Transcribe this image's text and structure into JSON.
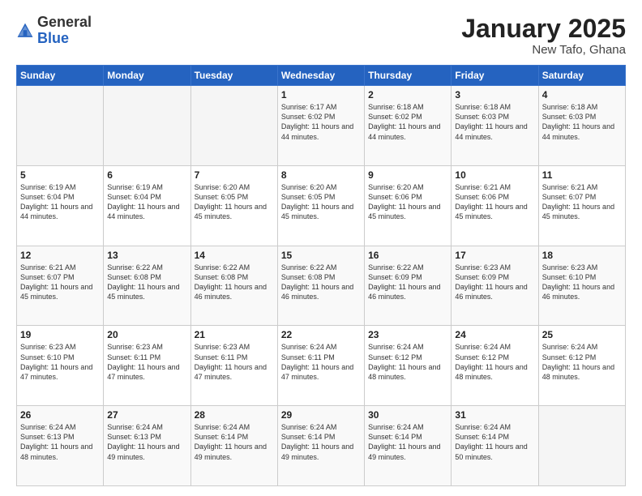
{
  "header": {
    "logo_general": "General",
    "logo_blue": "Blue",
    "month": "January 2025",
    "location": "New Tafo, Ghana"
  },
  "weekdays": [
    "Sunday",
    "Monday",
    "Tuesday",
    "Wednesday",
    "Thursday",
    "Friday",
    "Saturday"
  ],
  "weeks": [
    [
      {
        "day": "",
        "text": ""
      },
      {
        "day": "",
        "text": ""
      },
      {
        "day": "",
        "text": ""
      },
      {
        "day": "1",
        "text": "Sunrise: 6:17 AM\nSunset: 6:02 PM\nDaylight: 11 hours\nand 44 minutes."
      },
      {
        "day": "2",
        "text": "Sunrise: 6:18 AM\nSunset: 6:02 PM\nDaylight: 11 hours\nand 44 minutes."
      },
      {
        "day": "3",
        "text": "Sunrise: 6:18 AM\nSunset: 6:03 PM\nDaylight: 11 hours\nand 44 minutes."
      },
      {
        "day": "4",
        "text": "Sunrise: 6:18 AM\nSunset: 6:03 PM\nDaylight: 11 hours\nand 44 minutes."
      }
    ],
    [
      {
        "day": "5",
        "text": "Sunrise: 6:19 AM\nSunset: 6:04 PM\nDaylight: 11 hours\nand 44 minutes."
      },
      {
        "day": "6",
        "text": "Sunrise: 6:19 AM\nSunset: 6:04 PM\nDaylight: 11 hours\nand 44 minutes."
      },
      {
        "day": "7",
        "text": "Sunrise: 6:20 AM\nSunset: 6:05 PM\nDaylight: 11 hours\nand 45 minutes."
      },
      {
        "day": "8",
        "text": "Sunrise: 6:20 AM\nSunset: 6:05 PM\nDaylight: 11 hours\nand 45 minutes."
      },
      {
        "day": "9",
        "text": "Sunrise: 6:20 AM\nSunset: 6:06 PM\nDaylight: 11 hours\nand 45 minutes."
      },
      {
        "day": "10",
        "text": "Sunrise: 6:21 AM\nSunset: 6:06 PM\nDaylight: 11 hours\nand 45 minutes."
      },
      {
        "day": "11",
        "text": "Sunrise: 6:21 AM\nSunset: 6:07 PM\nDaylight: 11 hours\nand 45 minutes."
      }
    ],
    [
      {
        "day": "12",
        "text": "Sunrise: 6:21 AM\nSunset: 6:07 PM\nDaylight: 11 hours\nand 45 minutes."
      },
      {
        "day": "13",
        "text": "Sunrise: 6:22 AM\nSunset: 6:08 PM\nDaylight: 11 hours\nand 45 minutes."
      },
      {
        "day": "14",
        "text": "Sunrise: 6:22 AM\nSunset: 6:08 PM\nDaylight: 11 hours\nand 46 minutes."
      },
      {
        "day": "15",
        "text": "Sunrise: 6:22 AM\nSunset: 6:08 PM\nDaylight: 11 hours\nand 46 minutes."
      },
      {
        "day": "16",
        "text": "Sunrise: 6:22 AM\nSunset: 6:09 PM\nDaylight: 11 hours\nand 46 minutes."
      },
      {
        "day": "17",
        "text": "Sunrise: 6:23 AM\nSunset: 6:09 PM\nDaylight: 11 hours\nand 46 minutes."
      },
      {
        "day": "18",
        "text": "Sunrise: 6:23 AM\nSunset: 6:10 PM\nDaylight: 11 hours\nand 46 minutes."
      }
    ],
    [
      {
        "day": "19",
        "text": "Sunrise: 6:23 AM\nSunset: 6:10 PM\nDaylight: 11 hours\nand 47 minutes."
      },
      {
        "day": "20",
        "text": "Sunrise: 6:23 AM\nSunset: 6:11 PM\nDaylight: 11 hours\nand 47 minutes."
      },
      {
        "day": "21",
        "text": "Sunrise: 6:23 AM\nSunset: 6:11 PM\nDaylight: 11 hours\nand 47 minutes."
      },
      {
        "day": "22",
        "text": "Sunrise: 6:24 AM\nSunset: 6:11 PM\nDaylight: 11 hours\nand 47 minutes."
      },
      {
        "day": "23",
        "text": "Sunrise: 6:24 AM\nSunset: 6:12 PM\nDaylight: 11 hours\nand 48 minutes."
      },
      {
        "day": "24",
        "text": "Sunrise: 6:24 AM\nSunset: 6:12 PM\nDaylight: 11 hours\nand 48 minutes."
      },
      {
        "day": "25",
        "text": "Sunrise: 6:24 AM\nSunset: 6:12 PM\nDaylight: 11 hours\nand 48 minutes."
      }
    ],
    [
      {
        "day": "26",
        "text": "Sunrise: 6:24 AM\nSunset: 6:13 PM\nDaylight: 11 hours\nand 48 minutes."
      },
      {
        "day": "27",
        "text": "Sunrise: 6:24 AM\nSunset: 6:13 PM\nDaylight: 11 hours\nand 49 minutes."
      },
      {
        "day": "28",
        "text": "Sunrise: 6:24 AM\nSunset: 6:14 PM\nDaylight: 11 hours\nand 49 minutes."
      },
      {
        "day": "29",
        "text": "Sunrise: 6:24 AM\nSunset: 6:14 PM\nDaylight: 11 hours\nand 49 minutes."
      },
      {
        "day": "30",
        "text": "Sunrise: 6:24 AM\nSunset: 6:14 PM\nDaylight: 11 hours\nand 49 minutes."
      },
      {
        "day": "31",
        "text": "Sunrise: 6:24 AM\nSunset: 6:14 PM\nDaylight: 11 hours\nand 50 minutes."
      },
      {
        "day": "",
        "text": ""
      }
    ]
  ]
}
